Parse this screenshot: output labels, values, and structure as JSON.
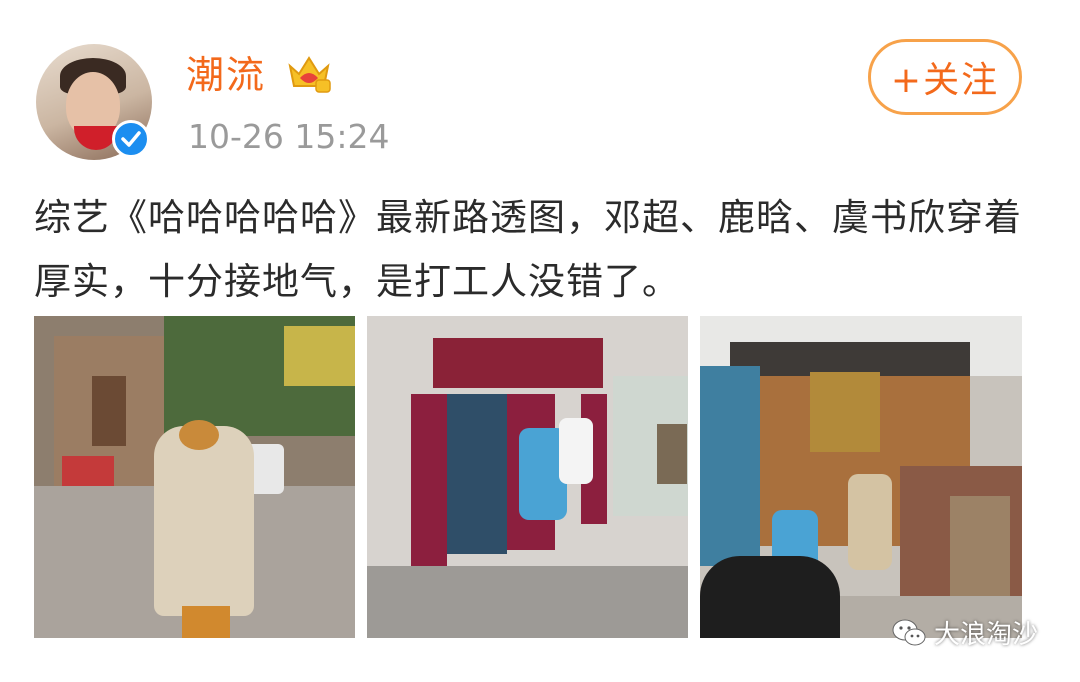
{
  "post": {
    "username": "潮流",
    "timestamp": "10-26 15:24",
    "follow_label": "+关注",
    "text": "综艺《哈哈哈哈哈》最新路透图，邓超、鹿晗、虞书欣穿着厚实，十分接地气，是打工人没错了。"
  },
  "watermark": {
    "text": "大浪淘沙"
  },
  "colors": {
    "accent": "#f3691b",
    "follow_border": "#f7a24a",
    "verified": "#1c8ef0"
  }
}
